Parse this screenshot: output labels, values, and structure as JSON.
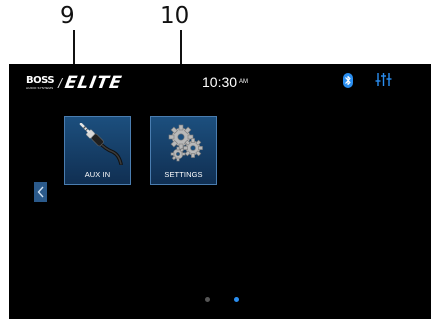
{
  "callouts": {
    "first": "9",
    "second": "10"
  },
  "status_bar": {
    "brand_main": "BOSS",
    "brand_sub": "AUDIO SYSTEMS",
    "brand_slash": "/",
    "brand_product": "ELITE",
    "time": "10:30",
    "ampm": "AM",
    "bluetooth_icon": "bluetooth-icon",
    "equalizer_icon": "equalizer-icon"
  },
  "apps": [
    {
      "label": "AUX IN",
      "icon": "aux-cable-icon"
    },
    {
      "label": "SETTINGS",
      "icon": "gears-icon"
    }
  ],
  "pagination": {
    "total": 2,
    "current": 2
  },
  "colors": {
    "screen_bg": "#000000",
    "tile_bg": "#1c4f7e",
    "tile_border": "#4a7db0",
    "accent_blue": "#2a8ef0",
    "dot_inactive": "#555555"
  }
}
